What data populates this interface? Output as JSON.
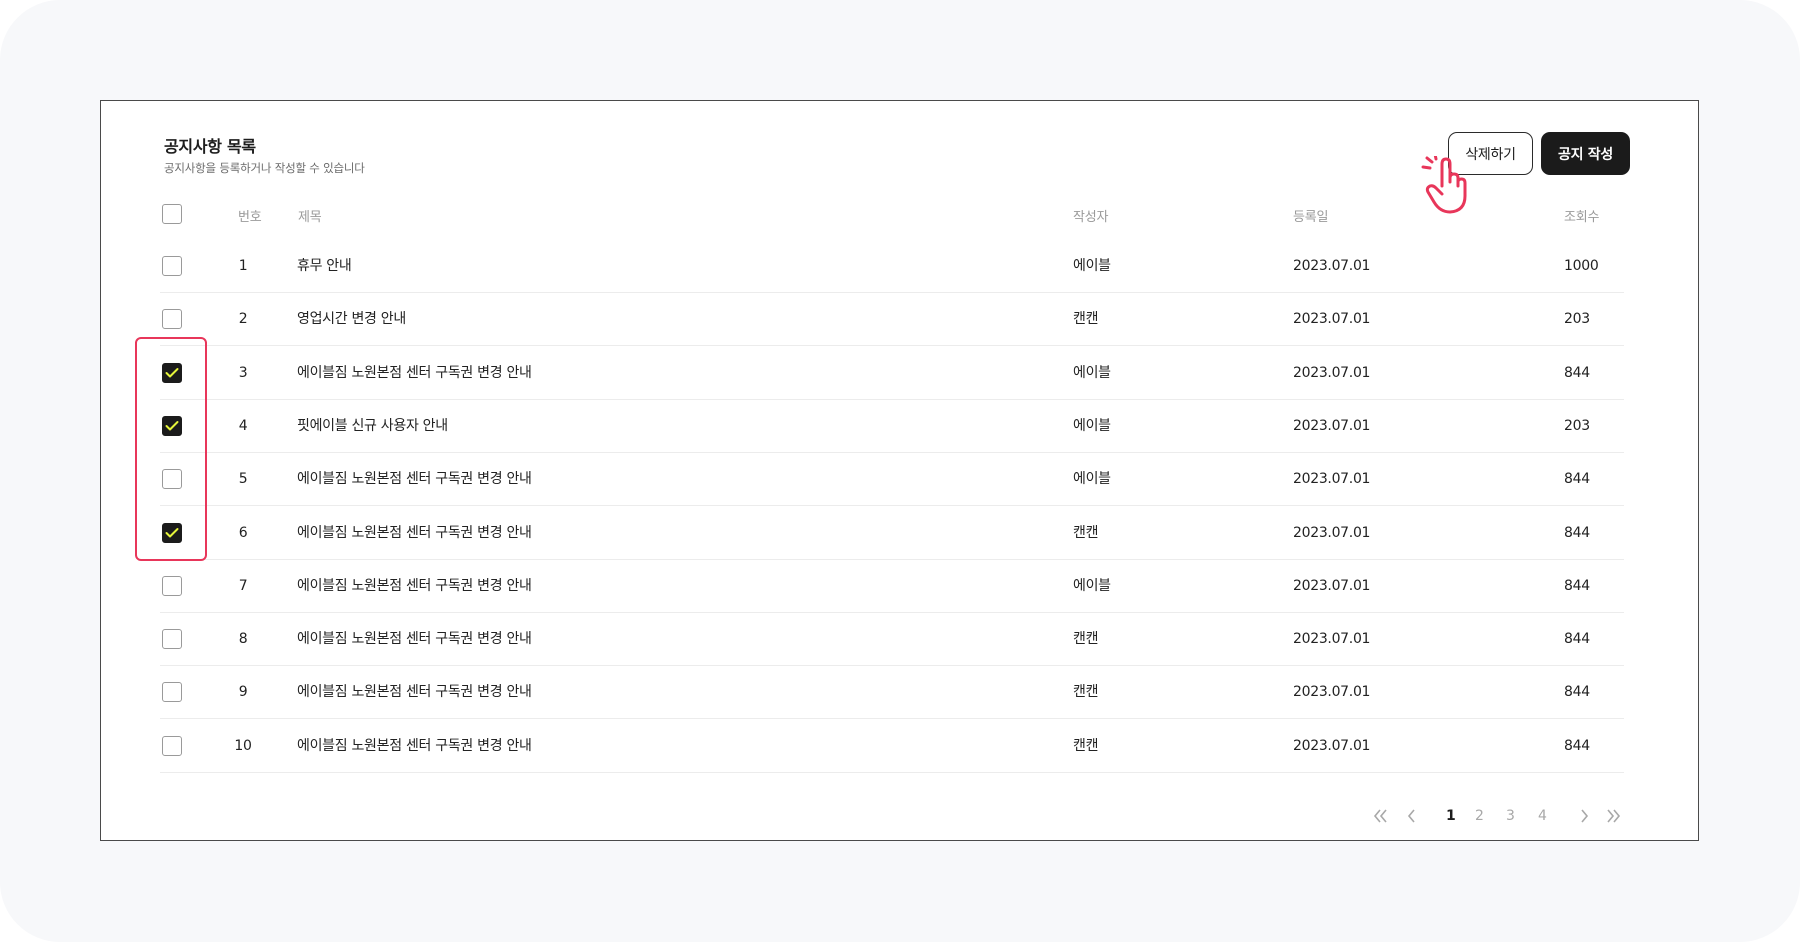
{
  "header": {
    "title": "공지사항 목록",
    "subtitle": "공지사항을 등록하거나 작성할 수 있습니다"
  },
  "actions": {
    "delete_label": "삭제하기",
    "write_label": "공지 작성"
  },
  "table": {
    "columns": {
      "number": "번호",
      "title": "제목",
      "author": "작성자",
      "date": "등록일",
      "views": "조회수"
    },
    "rows": [
      {
        "number": "1",
        "title": "휴무 안내",
        "author": "에이블",
        "date": "2023.07.01",
        "views": "1000",
        "checked": false
      },
      {
        "number": "2",
        "title": "영업시간 변경 안내",
        "author": "캔캔",
        "date": "2023.07.01",
        "views": "203",
        "checked": false
      },
      {
        "number": "3",
        "title": "에이블짐 노원본점 센터 구독권 변경 안내",
        "author": "에이블",
        "date": "2023.07.01",
        "views": "844",
        "checked": true
      },
      {
        "number": "4",
        "title": "핏에이블 신규 사용자 안내",
        "author": "에이블",
        "date": "2023.07.01",
        "views": "203",
        "checked": true
      },
      {
        "number": "5",
        "title": "에이블짐 노원본점 센터 구독권 변경 안내",
        "author": "에이블",
        "date": "2023.07.01",
        "views": "844",
        "checked": false
      },
      {
        "number": "6",
        "title": "에이블짐 노원본점 센터 구독권 변경 안내",
        "author": "캔캔",
        "date": "2023.07.01",
        "views": "844",
        "checked": true
      },
      {
        "number": "7",
        "title": "에이블짐 노원본점 센터 구독권 변경 안내",
        "author": "에이블",
        "date": "2023.07.01",
        "views": "844",
        "checked": false
      },
      {
        "number": "8",
        "title": "에이블짐 노원본점 센터 구독권 변경 안내",
        "author": "캔캔",
        "date": "2023.07.01",
        "views": "844",
        "checked": false
      },
      {
        "number": "9",
        "title": "에이블짐 노원본점 센터 구독권 변경 안내",
        "author": "캔캔",
        "date": "2023.07.01",
        "views": "844",
        "checked": false
      },
      {
        "number": "10",
        "title": "에이블짐 노원본점 센터 구독권 변경 안내",
        "author": "캔캔",
        "date": "2023.07.01",
        "views": "844",
        "checked": false
      }
    ]
  },
  "pagination": {
    "pages": [
      "1",
      "2",
      "3",
      "4"
    ],
    "current": "1"
  },
  "colors": {
    "accent_highlight": "#e8365a",
    "primary_button": "#1b1b1b",
    "checkmark": "#e6f53a"
  }
}
